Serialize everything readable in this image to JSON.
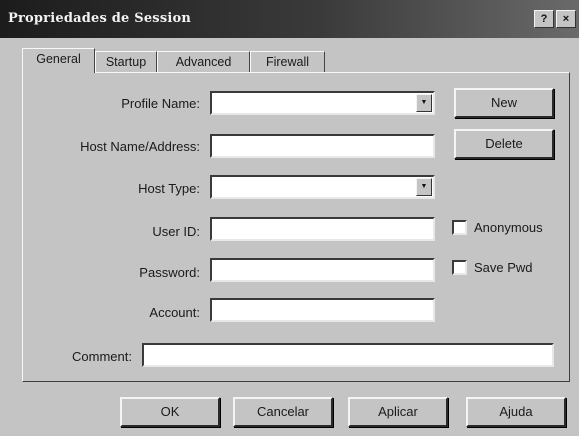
{
  "window": {
    "title": "Propriedades de Session",
    "help_glyph": "?",
    "close_glyph": "×"
  },
  "tabs": [
    {
      "label": "General",
      "active": true
    },
    {
      "label": "Startup",
      "active": false
    },
    {
      "label": "Advanced",
      "active": false
    },
    {
      "label": "Firewall",
      "active": false
    }
  ],
  "form": {
    "profile_name": {
      "label": "Profile Name:",
      "value": ""
    },
    "host_name": {
      "label": "Host Name/Address:",
      "value": ""
    },
    "host_type": {
      "label": "Host Type:",
      "value": ""
    },
    "user_id": {
      "label": "User ID:",
      "value": ""
    },
    "password": {
      "label": "Password:",
      "value": ""
    },
    "account": {
      "label": "Account:",
      "value": ""
    },
    "comment": {
      "label": "Comment:",
      "value": ""
    },
    "combo_arrow_glyph": "▼"
  },
  "side_buttons": {
    "new_label": "New",
    "delete_label": "Delete"
  },
  "checkboxes": {
    "anonymous": {
      "label": "Anonymous",
      "checked": false
    },
    "save_pwd": {
      "label": "Save Pwd",
      "checked": false
    }
  },
  "footer_buttons": {
    "ok_label": "OK",
    "cancel_label": "Cancelar",
    "apply_label": "Aplicar",
    "help_label": "Ajuda"
  }
}
